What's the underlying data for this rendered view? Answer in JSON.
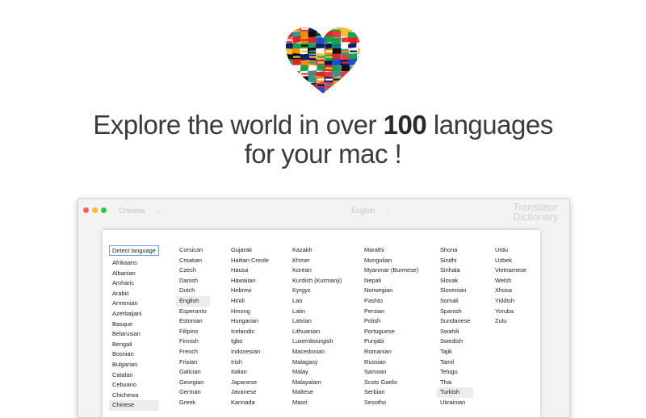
{
  "hero": {
    "line1_pre": "Explore the world in over ",
    "line1_bold": "100",
    "line1_post": " languages",
    "line2": "for your mac !",
    "heart_icon": "flag-mosaic-heart-icon"
  },
  "window": {
    "source_language": "Chinese",
    "target_language": "English",
    "brand_line1": "Translator",
    "brand_line2": "Dictionary",
    "colors": {
      "close": "#fc5f57",
      "minimize": "#fdbc2e",
      "zoom": "#2ac940",
      "focus": "#6f9fd8"
    }
  },
  "languages": {
    "columns": [
      {
        "items": [
          "Detect language",
          "Afrikaans",
          "Albanian",
          "Amharic",
          "Arabic",
          "Armenian",
          "Azerbaijani",
          "Basque",
          "Belarusian",
          "Bengali",
          "Bosnian",
          "Bulgarian",
          "Catalan",
          "Cebuano",
          "Chichewa",
          "Chinese"
        ],
        "highlight": 15,
        "boxed": 0
      },
      {
        "items": [
          "Corsican",
          "Croatian",
          "Czech",
          "Danish",
          "Dutch",
          "English",
          "Esperanto",
          "Estonian",
          "Filipino",
          "Finnish",
          "French",
          "Frisian",
          "Galician",
          "Georgian",
          "German",
          "Greek"
        ],
        "highlight": 5
      },
      {
        "items": [
          "Gujarati",
          "Haitian Creole",
          "Hausa",
          "Hawaiian",
          "Hebrew",
          "Hindi",
          "Hmong",
          "Hungarian",
          "Icelandic",
          "Igbo",
          "Indonesian",
          "Irish",
          "Italian",
          "Japanese",
          "Javanese",
          "Kannada"
        ]
      },
      {
        "items": [
          "Kazakh",
          "Khmer",
          "Korean",
          "Kurdish (Kurmanji)",
          "Kyrgyz",
          "Lao",
          "Latin",
          "Latvian",
          "Lithuanian",
          "Luxembourgish",
          "Macedonian",
          "Malagasy",
          "Malay",
          "Malayalam",
          "Maltese",
          "Maori"
        ]
      },
      {
        "items": [
          "Marathi",
          "Mongolian",
          "Myanmar (Burmese)",
          "Nepali",
          "Norwegian",
          "Pashto",
          "Persian",
          "Polish",
          "Portuguese",
          "Punjabi",
          "Romanian",
          "Russian",
          "Samoan",
          "Scots Gaelic",
          "Serbian",
          "Sesotho"
        ]
      },
      {
        "items": [
          "Shona",
          "Sindhi",
          "Sinhala",
          "Slovak",
          "Slovenian",
          "Somali",
          "Spanish",
          "Sundanese",
          "Swahili",
          "Swedish",
          "Tajik",
          "Tamil",
          "Telugu",
          "Thai",
          "Turkish",
          "Ukrainian"
        ],
        "highlight": 14
      },
      {
        "items": [
          "Urdu",
          "Uzbek",
          "Vietnamese",
          "Welsh",
          "Xhosa",
          "Yiddish",
          "Yoruba",
          "Zulu"
        ]
      }
    ]
  }
}
